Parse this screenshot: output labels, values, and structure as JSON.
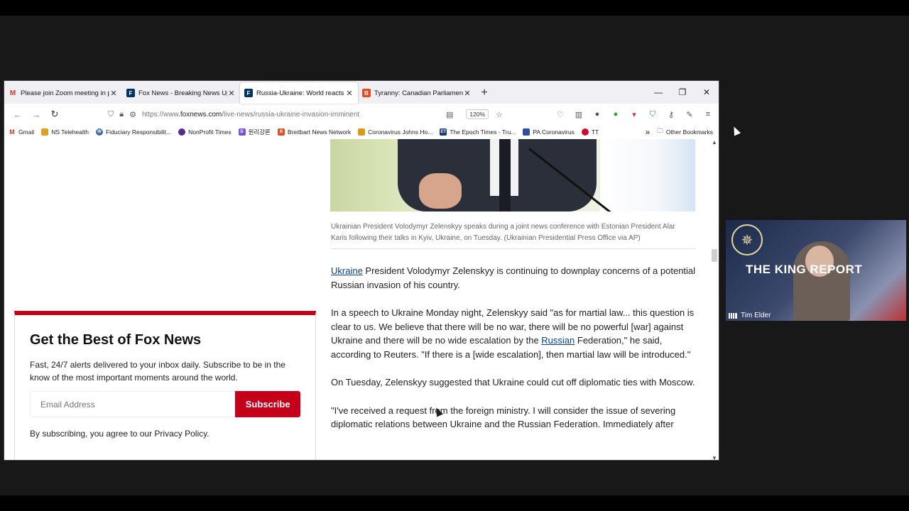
{
  "tabs": [
    {
      "title": "Please join Zoom meeting in pr",
      "favicon": "gmail-icon",
      "color": "#d93025",
      "active": false
    },
    {
      "title": "Fox News - Breaking News Upd",
      "favicon": "fox-news-icon",
      "color": "#003366",
      "active": false
    },
    {
      "title": "Russia-Ukraine: World reacts as",
      "favicon": "fox-news-icon",
      "color": "#003366",
      "active": true
    },
    {
      "title": "Tyranny: Canadian Parliament V",
      "favicon": "breitbart-icon",
      "color": "#e8491d",
      "active": false
    }
  ],
  "window_controls": {
    "minimize": "—",
    "restore": "❐",
    "close": "✕"
  },
  "nav": {
    "url_prefix": "https://www.",
    "url_domain": "foxnews.com",
    "url_path": "/live-news/russia-ukraine-invasion-imminent",
    "zoom": "120%"
  },
  "bookmarks": [
    {
      "label": "Gmail",
      "icon": "gmail-icon",
      "color": "#d93025"
    },
    {
      "label": "NS Telehealth",
      "icon": "folder-icon",
      "color": "#e0a020"
    },
    {
      "label": "Fiduciary Responsibilit...",
      "icon": "wordpress-icon",
      "color": "#3a6ea5"
    },
    {
      "label": "NonProfit Times",
      "icon": "globe-icon",
      "color": "#552a8a"
    },
    {
      "label": "원리강론",
      "icon": "book-icon",
      "color": "#7b4fd6"
    },
    {
      "label": "Breitbart News Network",
      "icon": "breitbart-icon",
      "color": "#e8491d"
    },
    {
      "label": "Coronavirus Johns Ho...",
      "icon": "jhu-icon",
      "color": "#d99a16"
    },
    {
      "label": "The Epoch Times - Tru...",
      "icon": "epoch-times-icon",
      "color": "#1a3a7a"
    },
    {
      "label": "PA Coronavirus",
      "icon": "pa-icon",
      "color": "#2c4fa0"
    },
    {
      "label": "TT",
      "icon": "tt-icon",
      "color": "#c8102e"
    }
  ],
  "bookmarks_overflow": "»",
  "other_bookmarks": "Other Bookmarks",
  "article": {
    "caption": "Ukrainian President Volodymyr Zelenskyy speaks during a joint news conference with Estonian President Alar Karis following their talks in Kyiv, Ukraine, on Tuesday. (Ukrainian Presidential Press Office via AP)",
    "p1_link": "Ukraine",
    "p1_rest": " President Volodymyr Zelenskyy is continuing to downplay concerns of a potential Russian invasion of his country.",
    "p2_a": "In a speech to Ukraine Monday night, Zelenskyy said \"as for martial law... this question is clear to us. We believe that there will be no war, there will be no powerful [war] against Ukraine and there will be no wide escalation by the ",
    "p2_link": "Russian",
    "p2_b": " Federation,\" he said, according to Reuters. \"If there is a [wide escalation], then martial law will be introduced.\"",
    "p3": "On Tuesday, Zelenskyy suggested that Ukraine could cut off diplomatic ties with Moscow.",
    "p4": "\"I've received a request from the foreign ministry. I will consider the issue of severing diplomatic relations between Ukraine and the Russian Federation. Immediately after"
  },
  "newsletter": {
    "heading": "Get the Best of Fox News",
    "description": "Fast, 24/7 alerts delivered to your inbox daily. Subscribe to be in the know of the most important moments around the world.",
    "email_placeholder": "Email Address",
    "subscribe_label": "Subscribe",
    "legal": "By subscribing, you agree to our Privacy Policy."
  },
  "video": {
    "title": "THE KING REPORT",
    "participant": "Tim Elder"
  },
  "colors": {
    "accent_red": "#c4001a",
    "link_blue": "#0b3f8f"
  }
}
